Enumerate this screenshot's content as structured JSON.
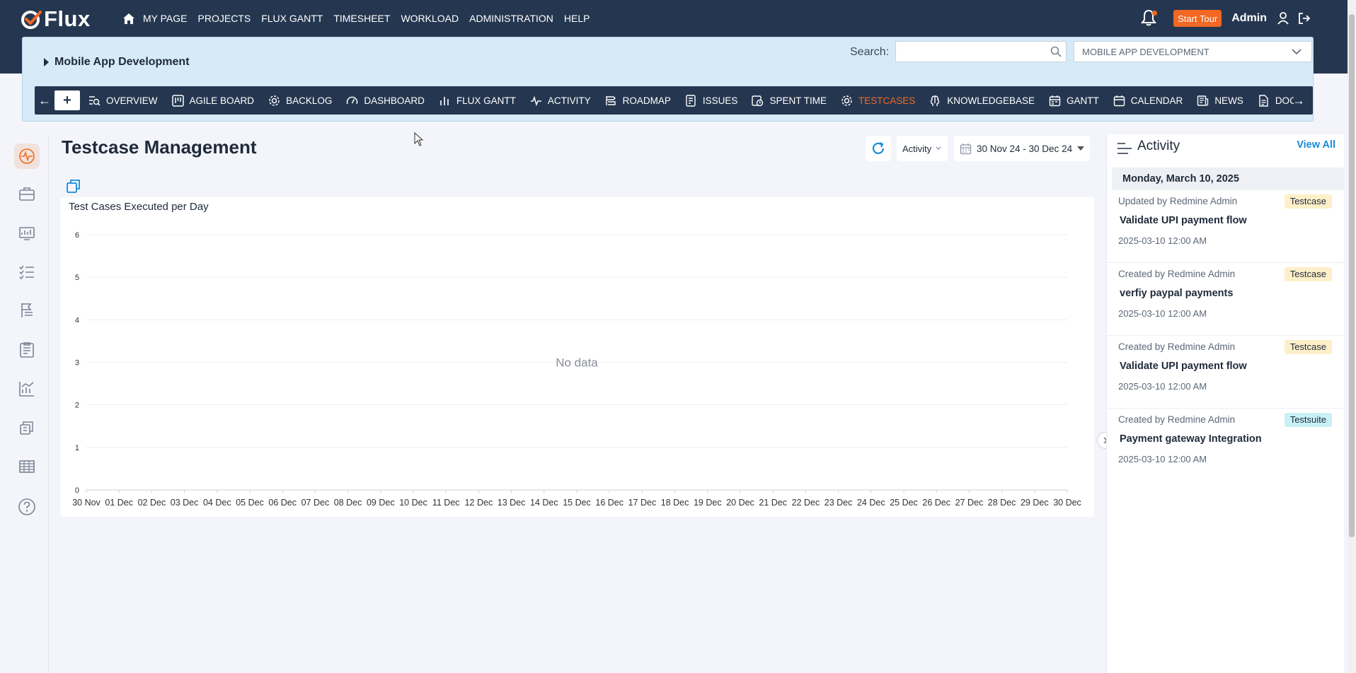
{
  "app": {
    "logo_text": "Flux"
  },
  "topnav": {
    "items": [
      "MY PAGE",
      "PROJECTS",
      "FLUX GANTT",
      "TIMESHEET",
      "WORKLOAD",
      "ADMINISTRATION",
      "HELP"
    ],
    "start_tour": "Start Tour",
    "user": "Admin"
  },
  "project": {
    "name": "Mobile App Development",
    "search_label": "Search:",
    "search_value": "",
    "selector_value": "MOBILE APP DEVELOPMENT"
  },
  "modules": [
    {
      "label": "OVERVIEW",
      "icon": "overview-icon"
    },
    {
      "label": "AGILE BOARD",
      "icon": "board-icon"
    },
    {
      "label": "BACKLOG",
      "icon": "gear-icon"
    },
    {
      "label": "DASHBOARD",
      "icon": "gauge-icon"
    },
    {
      "label": "FLUX GANTT",
      "icon": "bars-icon"
    },
    {
      "label": "ACTIVITY",
      "icon": "pulse-icon"
    },
    {
      "label": "ROADMAP",
      "icon": "roadmap-icon"
    },
    {
      "label": "ISSUES",
      "icon": "issues-icon"
    },
    {
      "label": "SPENT TIME",
      "icon": "clock-icon"
    },
    {
      "label": "TESTCASES",
      "icon": "gear-icon",
      "active": true
    },
    {
      "label": "KNOWLEDGEBASE",
      "icon": "brain-icon"
    },
    {
      "label": "GANTT",
      "icon": "calendar-icon"
    },
    {
      "label": "CALENDAR",
      "icon": "calendar-icon"
    },
    {
      "label": "NEWS",
      "icon": "news-icon"
    },
    {
      "label": "DOCUMENTS",
      "icon": "doc-icon"
    }
  ],
  "main": {
    "title": "Testcase Management",
    "activity_select": "Activity",
    "date_range": "30 Nov 24 - 30 Dec 24"
  },
  "chart_data": {
    "type": "bar",
    "title": "Test Cases Executed per Day",
    "categories": [
      "30 Nov",
      "01 Dec",
      "02 Dec",
      "03 Dec",
      "04 Dec",
      "05 Dec",
      "06 Dec",
      "07 Dec",
      "08 Dec",
      "09 Dec",
      "10 Dec",
      "11 Dec",
      "12 Dec",
      "13 Dec",
      "14 Dec",
      "15 Dec",
      "16 Dec",
      "17 Dec",
      "18 Dec",
      "19 Dec",
      "20 Dec",
      "21 Dec",
      "22 Dec",
      "23 Dec",
      "24 Dec",
      "25 Dec",
      "26 Dec",
      "27 Dec",
      "28 Dec",
      "29 Dec",
      "30 Dec"
    ],
    "values": [],
    "ylim": [
      0,
      6
    ],
    "yticks": [
      0,
      1,
      2,
      3,
      4,
      5,
      6
    ],
    "empty_text": "No data",
    "grid": true
  },
  "activity": {
    "title": "Activity",
    "view_all": "View All",
    "date_header": "Monday, March 10, 2025",
    "entries": [
      {
        "by": "Updated by Redmine Admin",
        "badge": "Testcase",
        "subject": "Validate UPI payment flow",
        "time": "2025-03-10 12:00 AM"
      },
      {
        "by": "Created by Redmine Admin",
        "badge": "Testcase",
        "subject": "verfiy paypal payments",
        "time": "2025-03-10 12:00 AM"
      },
      {
        "by": "Created by Redmine Admin",
        "badge": "Testcase",
        "subject": "Validate UPI payment flow",
        "time": "2025-03-10 12:00 AM"
      },
      {
        "by": "Created by Redmine Admin",
        "badge": "Testsuite",
        "subject": "Payment gateway Integration",
        "time": "2025-03-10 12:00 AM"
      }
    ]
  },
  "colors": {
    "nav": "#253750",
    "accent": "#f26722",
    "link": "#1a8cd8"
  }
}
